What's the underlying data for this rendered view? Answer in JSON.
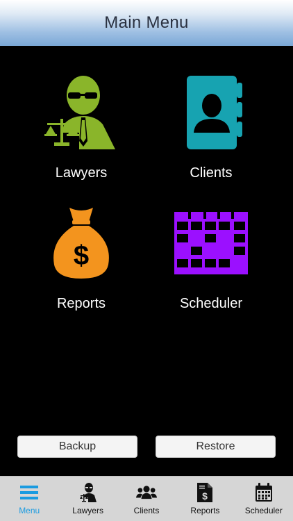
{
  "header": {
    "title": "Main Menu"
  },
  "tiles": [
    {
      "label": "Lawyers",
      "icon": "lawyer-icon",
      "color": "#8ab52a"
    },
    {
      "label": "Clients",
      "icon": "contacts-book-icon",
      "color": "#17a3b1"
    },
    {
      "label": "Reports",
      "icon": "money-bag-icon",
      "color": "#f3941e"
    },
    {
      "label": "Scheduler",
      "icon": "calendar-grid-icon",
      "color": "#9b10ff"
    }
  ],
  "actions": {
    "backup": "Backup",
    "restore": "Restore"
  },
  "tabs": [
    {
      "label": "Menu",
      "icon": "hamburger-menu-icon",
      "active": true
    },
    {
      "label": "Lawyers",
      "icon": "lawyer-icon",
      "active": false
    },
    {
      "label": "Clients",
      "icon": "users-group-icon",
      "active": false
    },
    {
      "label": "Reports",
      "icon": "dollar-document-icon",
      "active": false
    },
    {
      "label": "Scheduler",
      "icon": "calendar-icon",
      "active": false
    }
  ],
  "colors": {
    "accent": "#1a9be0",
    "background": "#000000",
    "tabbar": "#d6d6d6"
  }
}
